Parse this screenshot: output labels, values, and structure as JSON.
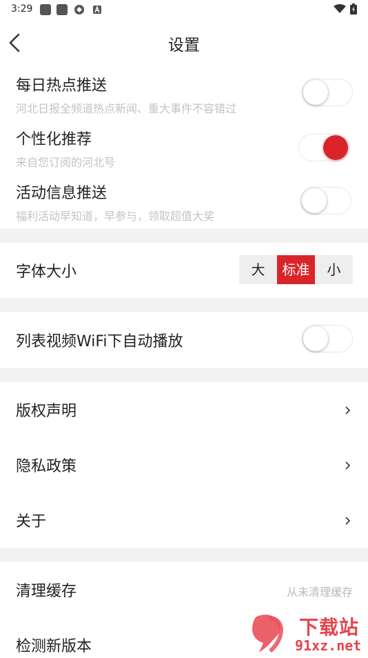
{
  "status_bar": {
    "time": "3:29"
  },
  "header": {
    "title": "设置"
  },
  "notifications": [
    {
      "title": "每日热点推送",
      "subtitle": "河北日报全频道热点新闻、重大事件不容错过",
      "enabled": false
    },
    {
      "title": "个性化推荐",
      "subtitle": "来自您订阅的河北号",
      "enabled": true
    },
    {
      "title": "活动信息推送",
      "subtitle": "福利活动早知道，早参与，领取超值大奖",
      "enabled": false
    }
  ],
  "font_size": {
    "label": "字体大小",
    "options": [
      "大",
      "标准",
      "小"
    ],
    "selected": "标准"
  },
  "video": {
    "label": "列表视频WiFi下自动播放",
    "enabled": false
  },
  "links": [
    {
      "label": "版权声明"
    },
    {
      "label": "隐私政策"
    },
    {
      "label": "关于"
    }
  ],
  "cache": {
    "label": "清理缓存",
    "value": "从未清理缓存"
  },
  "update": {
    "label": "检测新版本"
  },
  "watermark": {
    "text1": "下载站",
    "text2": "91xz.net"
  },
  "colors": {
    "accent": "#d9252a",
    "divider": "#f2f2f2",
    "subtitle": "#c3c3c3"
  }
}
